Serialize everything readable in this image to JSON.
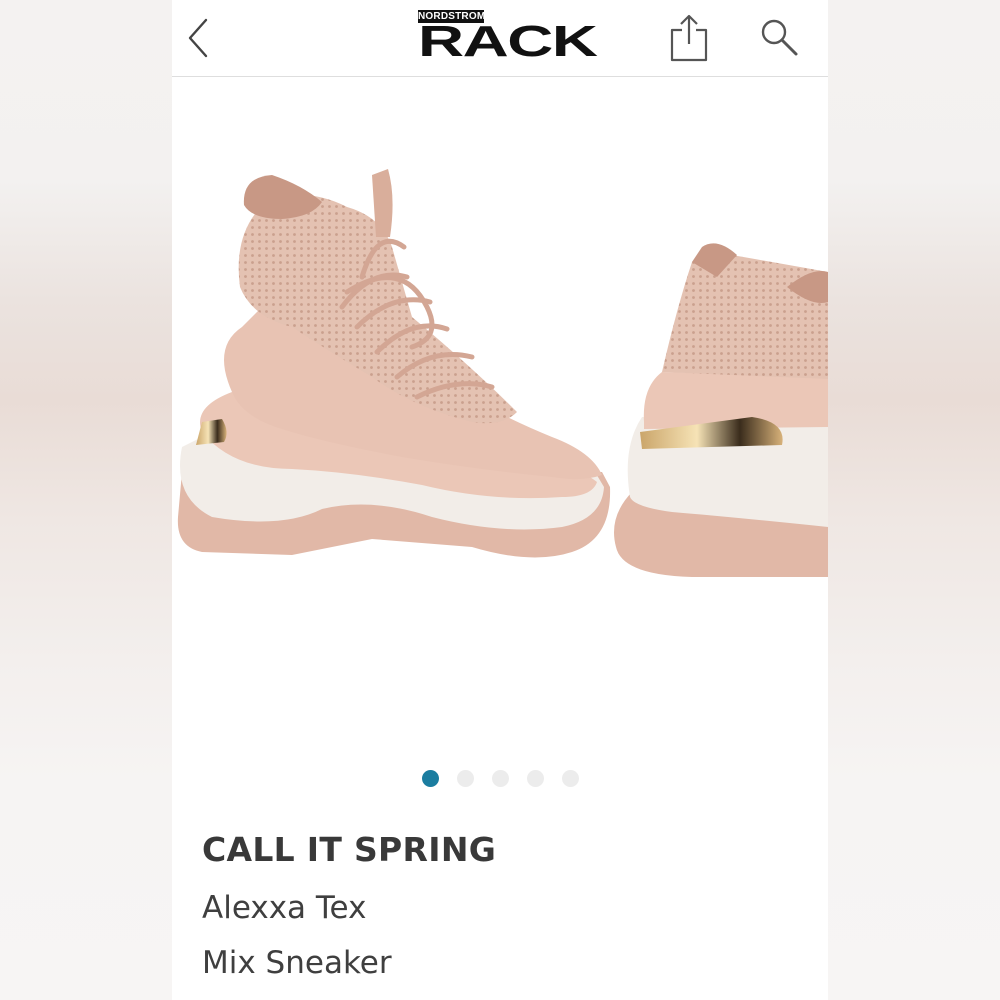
{
  "header": {
    "logo_small": "NORDSTROM",
    "logo_big": "RACK",
    "back_icon": "chevron-left-icon",
    "share_icon": "share-icon",
    "search_icon": "search-icon"
  },
  "gallery": {
    "image": "sneaker-product-photo",
    "dots": [
      {
        "active": true
      },
      {
        "active": false
      },
      {
        "active": false
      },
      {
        "active": false
      },
      {
        "active": false
      }
    ],
    "active_color": "#1b7da0",
    "inactive_color": "#ececec"
  },
  "product": {
    "brand": "CALL IT SPRING",
    "name_line1": "Alexxa Tex",
    "name_line2": "Mix Sneaker"
  }
}
